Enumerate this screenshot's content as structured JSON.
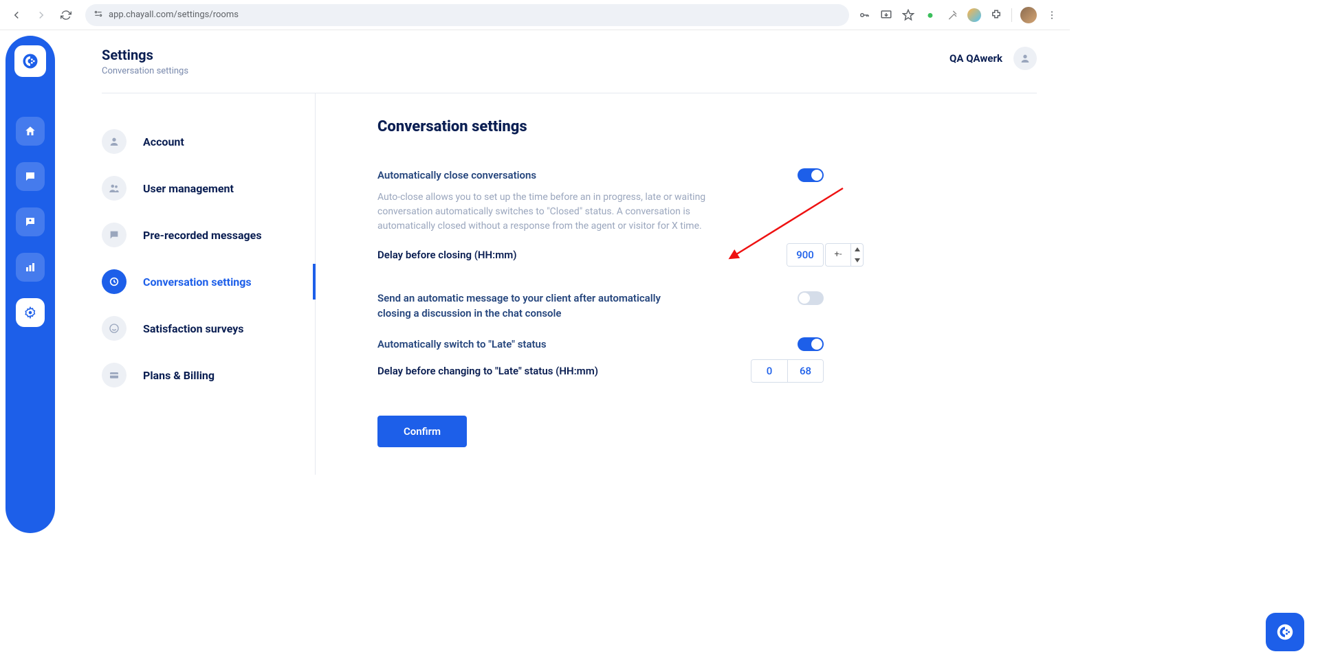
{
  "browser": {
    "url": "app.chayall.com/settings/rooms"
  },
  "header": {
    "title": "Settings",
    "subtitle": "Conversation settings"
  },
  "user": {
    "name": "QA QAwerk"
  },
  "settings_nav": [
    {
      "label": "Account",
      "icon": "person"
    },
    {
      "label": "User management",
      "icon": "people"
    },
    {
      "label": "Pre-recorded messages",
      "icon": "chat"
    },
    {
      "label": "Conversation settings",
      "icon": "clock",
      "active": true
    },
    {
      "label": "Satisfaction surveys",
      "icon": "smile"
    },
    {
      "label": "Plans & Billing",
      "icon": "wallet"
    }
  ],
  "body": {
    "title": "Conversation settings",
    "auto_close_label": "Automatically close conversations",
    "auto_close_desc": "Auto-close allows you to set up the time before an in progress, late or waiting conversation automatically switches to \"Closed\" status. A conversation is automatically closed without a response from the agent or visitor for X time.",
    "auto_close_on": true,
    "delay_close_label": "Delay before closing (HH:mm)",
    "delay_close_hh": "900",
    "delay_close_mm": "+-",
    "auto_msg_label": "Send an automatic message to your client after automatically closing a discussion in the chat console",
    "auto_msg_on": false,
    "late_label": "Automatically switch to \"Late\" status",
    "late_on": true,
    "delay_late_label": "Delay before changing to \"Late\" status (HH:mm)",
    "delay_late_hh": "0",
    "delay_late_mm": "68",
    "confirm": "Confirm"
  }
}
